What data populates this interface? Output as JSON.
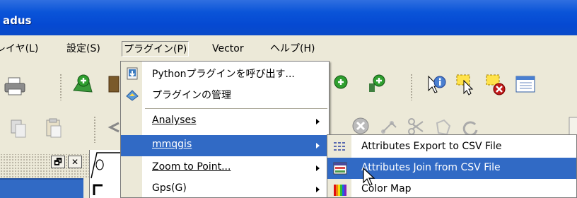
{
  "window": {
    "title": "adus"
  },
  "menubar": {
    "items": [
      {
        "label": "レイヤ(L)"
      },
      {
        "label": "設定(S)"
      },
      {
        "label": "プラグイン(P)"
      },
      {
        "label": "Vector"
      },
      {
        "label": "ヘルプ(H)"
      }
    ]
  },
  "plugin_menu": {
    "items": [
      {
        "label": "Pythonプラグインを呼び出す...",
        "icon": "python-plugin-icon"
      },
      {
        "label": "プラグインの管理",
        "icon": "plugin-manager-icon"
      },
      {
        "label": "Analyses",
        "has_submenu": true
      },
      {
        "label": "mmqgis",
        "has_submenu": true
      },
      {
        "label": "Zoom to Point...",
        "has_submenu": true
      },
      {
        "label": "Gps(G)",
        "has_submenu": true
      }
    ]
  },
  "mmqgis_submenu": {
    "items": [
      {
        "label": "Attributes Export to CSV File",
        "icon": "grid-icon"
      },
      {
        "label": "Attributes Join from CSV File",
        "icon": "table-join-icon"
      },
      {
        "label": "Color Map",
        "icon": "color-map-icon"
      }
    ]
  },
  "dock": {
    "float_label": "🗗",
    "close_label": "✕"
  },
  "colors": {
    "menu_highlight": "#316ac5",
    "titlebar": "#0a54d8",
    "chrome": "#ece9d8"
  }
}
